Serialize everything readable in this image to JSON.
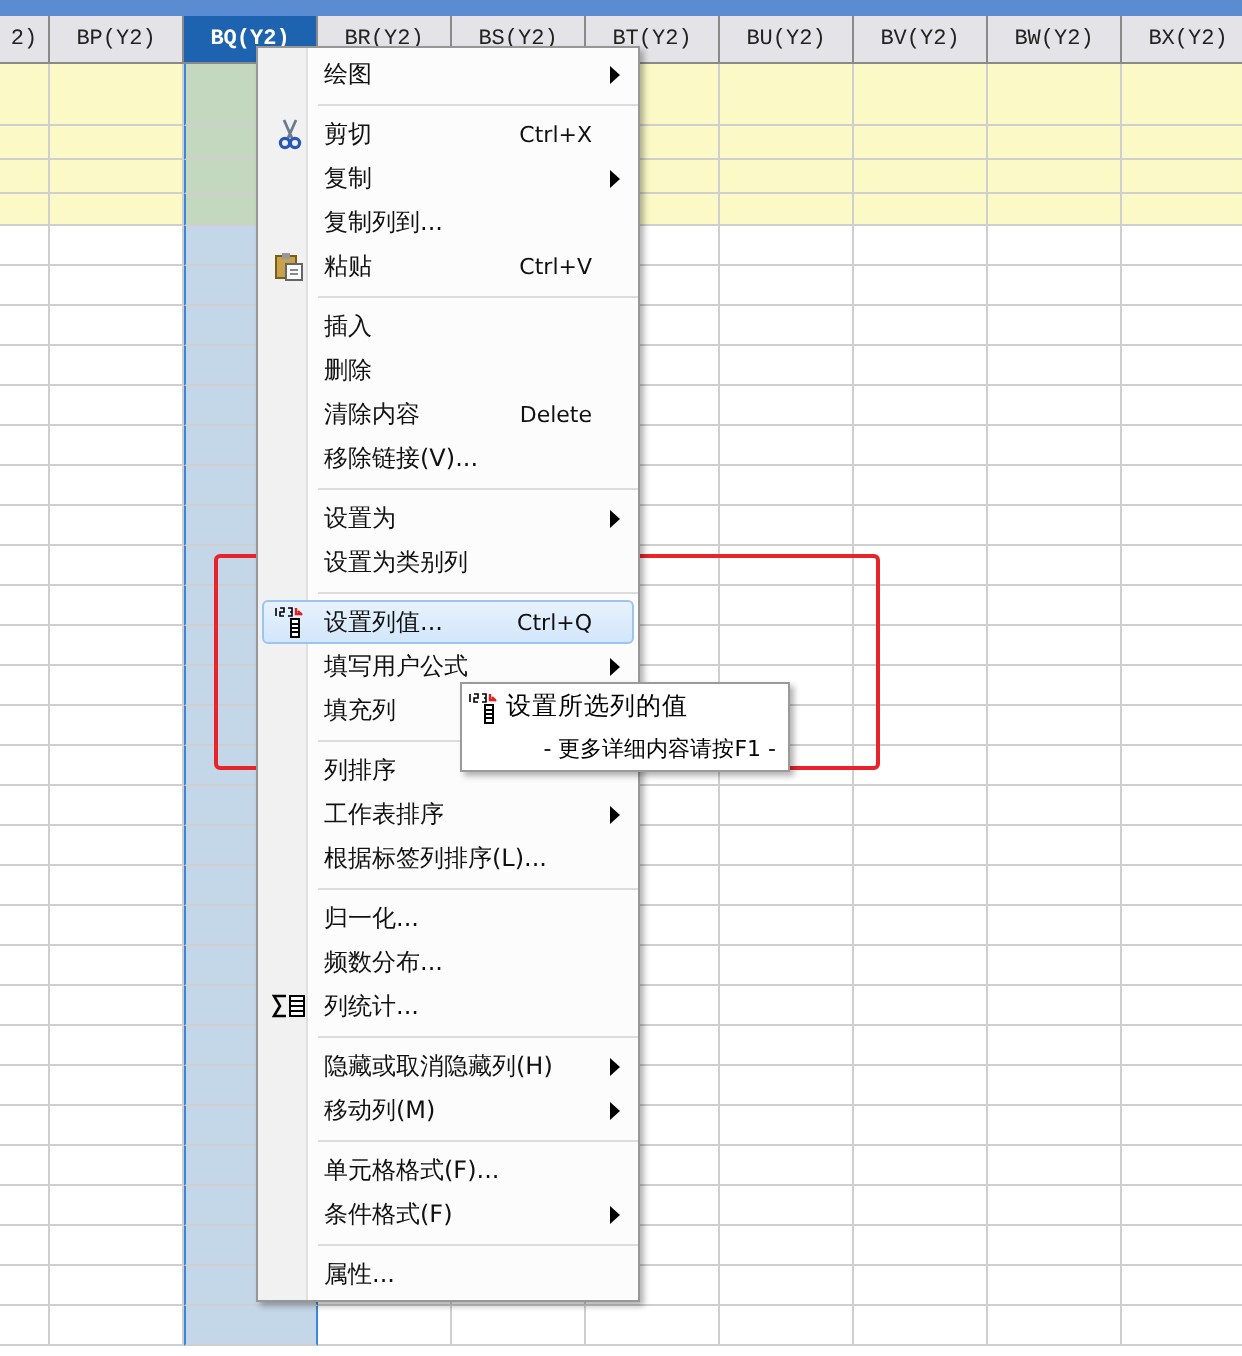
{
  "columns": [
    {
      "label": "2)",
      "selected": false
    },
    {
      "label": "BP(Y2)",
      "selected": false
    },
    {
      "label": "BQ(Y2)",
      "selected": true
    },
    {
      "label": "BR(Y2)",
      "selected": false
    },
    {
      "label": "BS(Y2)",
      "selected": false
    },
    {
      "label": "BT(Y2)",
      "selected": false
    },
    {
      "label": "BU(Y2)",
      "selected": false
    },
    {
      "label": "BV(Y2)",
      "selected": false
    },
    {
      "label": "BW(Y2)",
      "selected": false
    },
    {
      "label": "BX(Y2)",
      "selected": false
    }
  ],
  "rows": [
    {
      "highlighted": true
    },
    {
      "highlighted": true
    },
    {
      "highlighted": true
    },
    {
      "highlighted": true
    },
    {
      "highlighted": false
    },
    {
      "highlighted": false
    },
    {
      "highlighted": false
    },
    {
      "highlighted": false
    },
    {
      "highlighted": false
    },
    {
      "highlighted": false
    },
    {
      "highlighted": false
    },
    {
      "highlighted": false
    },
    {
      "highlighted": false
    },
    {
      "highlighted": false
    },
    {
      "highlighted": false
    },
    {
      "highlighted": false
    },
    {
      "highlighted": false
    },
    {
      "highlighted": false
    },
    {
      "highlighted": false
    },
    {
      "highlighted": false
    },
    {
      "highlighted": false
    },
    {
      "highlighted": false
    },
    {
      "highlighted": false
    },
    {
      "highlighted": false
    },
    {
      "highlighted": false
    },
    {
      "highlighted": false
    },
    {
      "highlighted": false
    },
    {
      "highlighted": false
    },
    {
      "highlighted": false
    },
    {
      "highlighted": false
    },
    {
      "highlighted": false
    },
    {
      "highlighted": false
    }
  ],
  "context_menu": {
    "items": [
      {
        "kind": "item",
        "label": "绘图",
        "submenu": true,
        "selected": false
      },
      {
        "kind": "separator"
      },
      {
        "kind": "item",
        "label": "剪切",
        "shortcut": "Ctrl+X",
        "submenu": false,
        "selected": false
      },
      {
        "kind": "item",
        "label": "复制",
        "submenu": true,
        "selected": false
      },
      {
        "kind": "item",
        "label": "复制列到...",
        "submenu": false,
        "selected": false
      },
      {
        "kind": "item",
        "label": "粘贴",
        "shortcut": "Ctrl+V",
        "submenu": false,
        "selected": false
      },
      {
        "kind": "separator"
      },
      {
        "kind": "item",
        "label": "插入",
        "submenu": false,
        "selected": false
      },
      {
        "kind": "item",
        "label": "删除",
        "submenu": false,
        "selected": false
      },
      {
        "kind": "item",
        "label": "清除内容",
        "shortcut": "Delete",
        "submenu": false,
        "selected": false
      },
      {
        "kind": "item",
        "label": "移除链接(V)...",
        "submenu": false,
        "selected": false
      },
      {
        "kind": "separator"
      },
      {
        "kind": "item",
        "label": "设置为",
        "submenu": true,
        "selected": false
      },
      {
        "kind": "item",
        "label": "设置为类别列",
        "submenu": false,
        "selected": false
      },
      {
        "kind": "separator"
      },
      {
        "kind": "item",
        "label": "设置列值...",
        "shortcut": "Ctrl+Q",
        "submenu": false,
        "selected": true
      },
      {
        "kind": "item",
        "label": "填写用户公式",
        "submenu": true,
        "selected": false
      },
      {
        "kind": "item",
        "label": "填充列",
        "selected": false
      },
      {
        "kind": "separator"
      },
      {
        "kind": "item",
        "label": "列排序",
        "submenu": false,
        "selected": false
      },
      {
        "kind": "item",
        "label": "工作表排序",
        "submenu": true,
        "selected": false
      },
      {
        "kind": "item",
        "label": "根据标签列排序(L)...",
        "submenu": false,
        "selected": false
      },
      {
        "kind": "separator"
      },
      {
        "kind": "item",
        "label": "归一化...",
        "submenu": false,
        "selected": false
      },
      {
        "kind": "item",
        "label": "频数分布...",
        "submenu": false,
        "selected": false
      },
      {
        "kind": "item",
        "label": "列统计...",
        "submenu": false,
        "selected": false
      },
      {
        "kind": "separator"
      },
      {
        "kind": "item",
        "label": "隐藏或取消隐藏列(H)",
        "submenu": true,
        "selected": false
      },
      {
        "kind": "item",
        "label": "移动列(M)",
        "submenu": true,
        "selected": false
      },
      {
        "kind": "separator"
      },
      {
        "kind": "item",
        "label": "单元格格式(F)...",
        "submenu": false,
        "selected": false
      },
      {
        "kind": "item",
        "label": "条件格式(F)",
        "submenu": true,
        "selected": false
      },
      {
        "kind": "separator"
      },
      {
        "kind": "item",
        "label": "属性...",
        "submenu": false,
        "selected": false
      }
    ]
  },
  "tooltip": {
    "title": "设置所选列的值",
    "hint": "- 更多详细内容请按F1 -"
  }
}
